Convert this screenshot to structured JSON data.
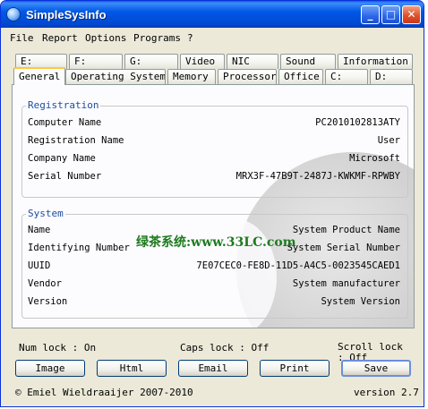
{
  "window": {
    "title": "SimpleSysInfo"
  },
  "titlebar_buttons": {
    "minimize": "_",
    "maximize": "□",
    "close": "✕"
  },
  "menu": [
    "File",
    "Report",
    "Options",
    "Programs",
    "?"
  ],
  "tabs_row1": [
    "E:",
    "F:",
    "G:",
    "Video",
    "NIC",
    "Sound",
    "Information"
  ],
  "tabs_row2": [
    "General",
    "Operating System",
    "Memory",
    "Processor",
    "Office",
    "C:",
    "D:"
  ],
  "active_tab": "General",
  "registration": {
    "legend": "Registration",
    "rows": [
      {
        "label": "Computer Name",
        "value": "PC2010102813ATY"
      },
      {
        "label": "Registration Name",
        "value": "User"
      },
      {
        "label": "Company Name",
        "value": "Microsoft"
      },
      {
        "label": "Serial Number",
        "value": "MRX3F-47B9T-2487J-KWKMF-RPWBY"
      }
    ]
  },
  "system": {
    "legend": "System",
    "rows": [
      {
        "label": "Name",
        "value": "System Product Name"
      },
      {
        "label": "Identifying Number",
        "value": "System Serial Number"
      },
      {
        "label": "UUID",
        "value": "7E07CEC0-FE8D-11D5-A4C5-0023545CAED1"
      },
      {
        "label": "Vendor",
        "value": "System manufacturer"
      },
      {
        "label": "Version",
        "value": "System Version"
      }
    ]
  },
  "watermark": "绿茶系统:www.33LC.com",
  "status": {
    "num_lock": "Num lock : On",
    "caps_lock": "Caps lock : Off",
    "scroll_lock": "Scroll lock : Off"
  },
  "buttons": [
    "Image",
    "Html",
    "Email",
    "Print",
    "Save"
  ],
  "footer": {
    "copyright": "© Emiel Wieldraaijer 2007-2010",
    "version": "version 2.7"
  }
}
